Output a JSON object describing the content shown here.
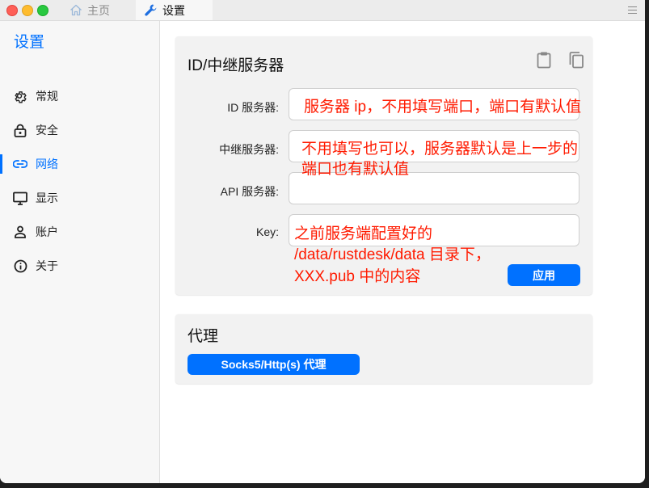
{
  "tabs": [
    {
      "label": "主页",
      "icon": "home-icon"
    },
    {
      "label": "设置",
      "icon": "wrench-icon"
    }
  ],
  "sidebar": {
    "title": "设置",
    "items": [
      {
        "label": "常规",
        "icon": "gear-icon"
      },
      {
        "label": "安全",
        "icon": "lock-icon"
      },
      {
        "label": "网络",
        "icon": "link-icon",
        "active": true
      },
      {
        "label": "显示",
        "icon": "monitor-icon"
      },
      {
        "label": "账户",
        "icon": "person-icon"
      },
      {
        "label": "关于",
        "icon": "info-icon"
      }
    ]
  },
  "server_card": {
    "title": "ID/中继服务器",
    "fields": [
      {
        "label": "ID 服务器:",
        "value": ""
      },
      {
        "label": "中继服务器:",
        "value": ""
      },
      {
        "label": "API 服务器:",
        "value": ""
      },
      {
        "label": "Key:",
        "value": ""
      }
    ],
    "apply_label": "应用"
  },
  "proxy_card": {
    "title": "代理",
    "button_label": "Socks5/Http(s) 代理"
  },
  "annotations": {
    "id_server": "服务器 ip，不用填写端口，端口有默认值",
    "relay_line1": "不用填写也可以，服务器默认是上一步的",
    "relay_line2": "端口也有默认值",
    "key_line1": "之前服务端配置好的",
    "key_line2": "/data/rustdesk/data 目录下，",
    "key_line3": "XXX.pub 中的内容"
  },
  "colors": {
    "accent": "#0071ff",
    "annotation": "#ff1a00"
  }
}
